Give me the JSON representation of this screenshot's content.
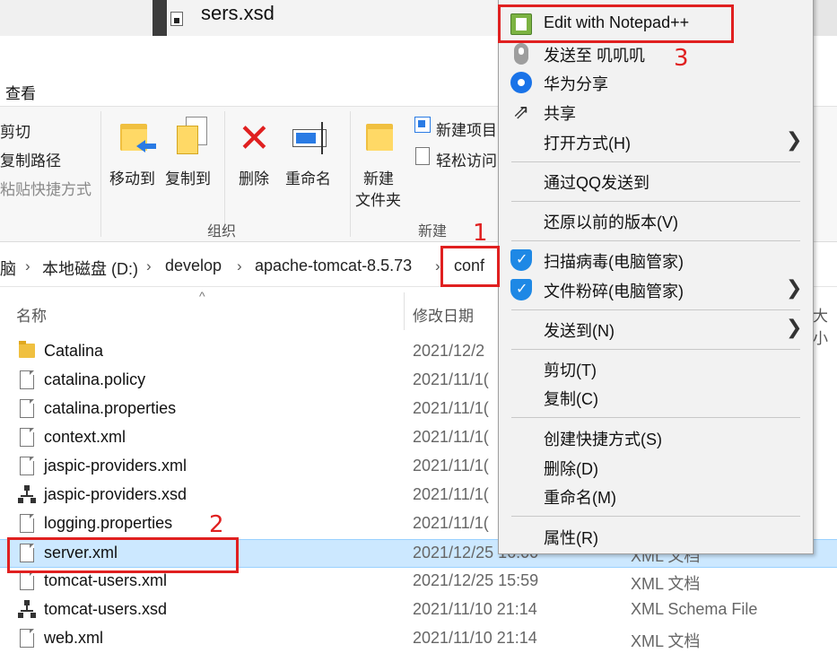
{
  "window": {
    "tab_title": "sers.xsd"
  },
  "ribbon": {
    "view_tab": "查看",
    "clipboard": {
      "cut": "剪切",
      "copy_path": "复制路径",
      "paste_shortcut": "粘贴快捷方式"
    },
    "organize": {
      "move_to": "移动到",
      "copy_to": "复制到",
      "delete": "删除",
      "rename": "重命名",
      "group_label": "组织"
    },
    "new": {
      "new_folder_line1": "新建",
      "new_folder_line2": "文件夹",
      "new_item": "新建项目",
      "easy_access": "轻松访问",
      "group_label": "新建"
    }
  },
  "breadcrumb": [
    "脑",
    "本地磁盘 (D:)",
    "develop",
    "apache-tomcat-8.5.73",
    "conf"
  ],
  "columns": {
    "name": "名称",
    "date": "修改日期",
    "size": "大小"
  },
  "files": [
    {
      "name": "Catalina",
      "date": "2021/12/2",
      "type": "",
      "icon": "folder-icon"
    },
    {
      "name": "catalina.policy",
      "date": "2021/11/1(",
      "type": "",
      "icon": "file-icon"
    },
    {
      "name": "catalina.properties",
      "date": "2021/11/1(",
      "type": "",
      "icon": "file-icon"
    },
    {
      "name": "context.xml",
      "date": "2021/11/1(",
      "type": "",
      "icon": "file-icon"
    },
    {
      "name": "jaspic-providers.xml",
      "date": "2021/11/1(",
      "type": "",
      "icon": "file-icon"
    },
    {
      "name": "jaspic-providers.xsd",
      "date": "2021/11/1(",
      "type": "",
      "icon": "xsd-icon"
    },
    {
      "name": "logging.properties",
      "date": "2021/11/1(",
      "type": "",
      "icon": "file-icon"
    },
    {
      "name": "server.xml",
      "date": "2021/12/25 16:00",
      "type": "XML 文档",
      "icon": "file-icon"
    },
    {
      "name": "tomcat-users.xml",
      "date": "2021/12/25 15:59",
      "type": "XML 文档",
      "icon": "file-icon"
    },
    {
      "name": "tomcat-users.xsd",
      "date": "2021/11/10 21:14",
      "type": "XML Schema File",
      "icon": "xsd-icon"
    },
    {
      "name": "web.xml",
      "date": "2021/11/10 21:14",
      "type": "XML 文档",
      "icon": "file-icon"
    }
  ],
  "context_menu": {
    "edit_npp": "Edit with Notepad++",
    "send_to_device": "发送至 叽叽叽",
    "huawei_share": "华为分享",
    "share": "共享",
    "open_with": "打开方式(H)",
    "send_qq": "通过QQ发送到",
    "restore_versions": "还原以前的版本(V)",
    "scan_virus": "扫描病毒(电脑管家)",
    "shred_file": "文件粉碎(电脑管家)",
    "send_to": "发送到(N)",
    "cut": "剪切(T)",
    "copy": "复制(C)",
    "create_shortcut": "创建快捷方式(S)",
    "delete": "删除(D)",
    "rename": "重命名(M)",
    "properties": "属性(R)",
    "share_glyph": "⇗",
    "submenu_arrow": "❯"
  },
  "annotations": {
    "one": "1",
    "two": "2",
    "three": "3"
  },
  "glyphs": {
    "delete_x": "✕",
    "sort_caret": "^",
    "crumb_sep": "›"
  },
  "colors": {
    "accent": "#2a7be4",
    "selection": "#cce8ff",
    "annotation": "#e02020"
  }
}
